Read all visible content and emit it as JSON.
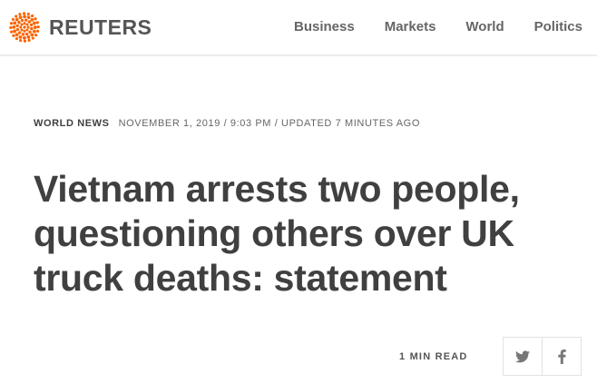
{
  "brand": {
    "name": "REUTERS",
    "accent_color": "#fa6400"
  },
  "nav": {
    "items": [
      {
        "label": "Business"
      },
      {
        "label": "Markets"
      },
      {
        "label": "World"
      },
      {
        "label": "Politics"
      }
    ]
  },
  "article": {
    "section": "WORLD NEWS",
    "dateline": "NOVEMBER 1, 2019 / 9:03 PM / UPDATED 7 MINUTES AGO",
    "headline": "Vietnam arrests two people, questioning others over UK truck deaths: statement",
    "read_time": "1 MIN READ"
  },
  "share": {
    "buttons": [
      {
        "icon": "twitter-icon"
      },
      {
        "icon": "facebook-icon"
      }
    ]
  }
}
